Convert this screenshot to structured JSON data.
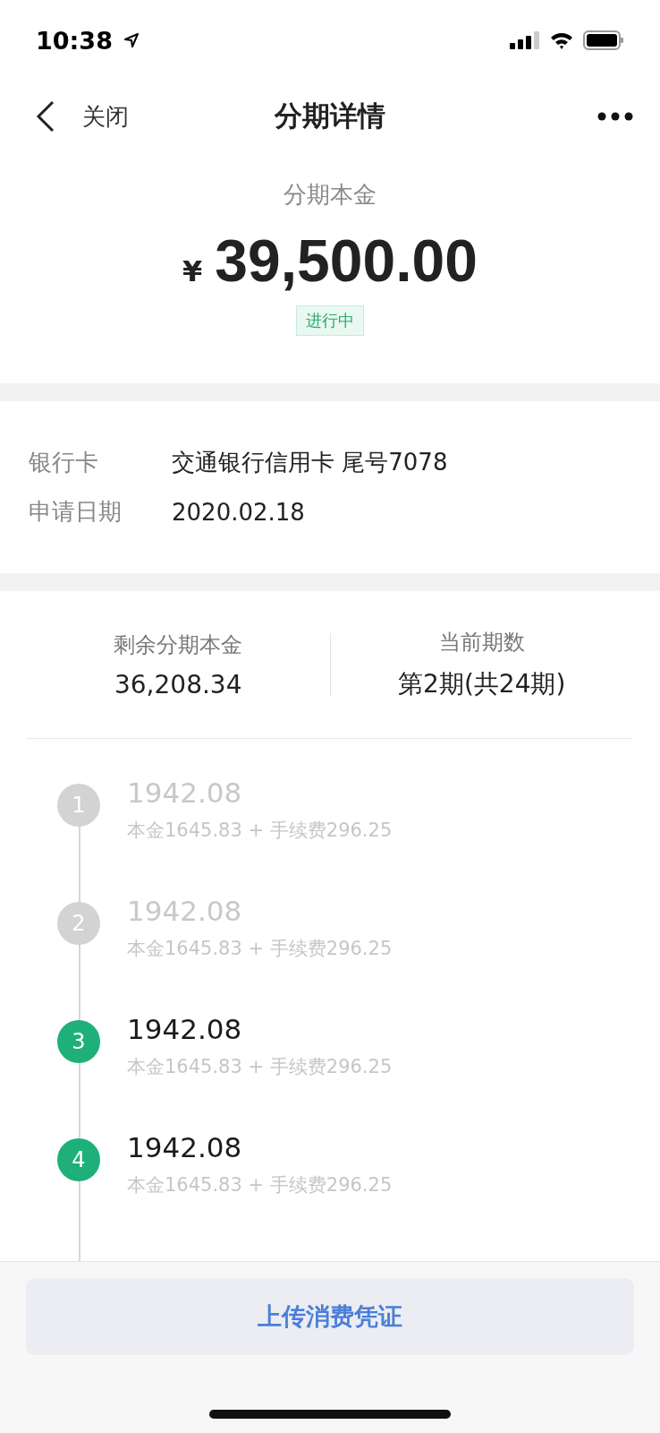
{
  "status_bar": {
    "time": "10:38"
  },
  "nav": {
    "back_label": "关闭",
    "title": "分期详情"
  },
  "principal": {
    "label": "分期本金",
    "currency": "¥",
    "amount": "39,500.00",
    "status": "进行中"
  },
  "info": [
    {
      "label": "银行卡",
      "value": "交通银行信用卡 尾号7078"
    },
    {
      "label": "申请日期",
      "value": "2020.02.18"
    }
  ],
  "summary": [
    {
      "label": "剩余分期本金",
      "value": "36,208.34"
    },
    {
      "label": "当前期数",
      "value": "第2期(共24期)"
    }
  ],
  "schedule": [
    {
      "number": "1",
      "amount": "1942.08",
      "detail": "本金1645.83 + 手续费296.25",
      "paid": true
    },
    {
      "number": "2",
      "amount": "1942.08",
      "detail": "本金1645.83 + 手续费296.25",
      "paid": true
    },
    {
      "number": "3",
      "amount": "1942.08",
      "detail": "本金1645.83 + 手续费296.25",
      "paid": false
    },
    {
      "number": "4",
      "amount": "1942.08",
      "detail": "本金1645.83 + 手续费296.25",
      "paid": false
    }
  ],
  "upload_button": "上传消费凭证"
}
